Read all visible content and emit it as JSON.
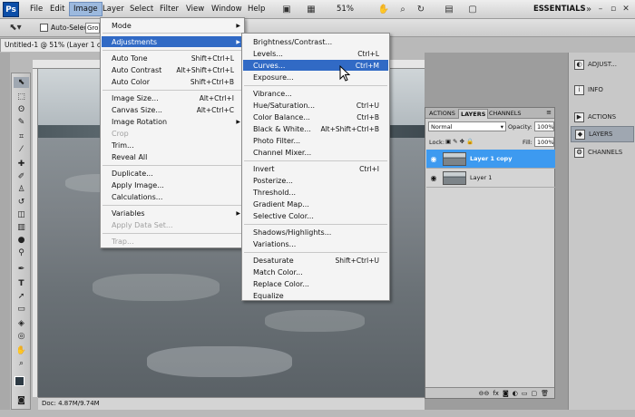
{
  "menubar": {
    "logo": "Ps",
    "items": [
      "File",
      "Edit",
      "Image",
      "Layer",
      "Select",
      "Filter",
      "View",
      "Window",
      "Help"
    ],
    "zoom": "51%",
    "workspace": "ESSENTIALS"
  },
  "options": {
    "auto_select": "Auto-Select:",
    "group_value": "Gro"
  },
  "document": {
    "tab": "Untitled-1 @ 51% (Layer 1 cop",
    "status": "Doc: 4.87M/9.74M"
  },
  "image_menu": [
    {
      "label": "Mode",
      "shortcut": "",
      "submenu": true
    },
    {
      "label": "Adjustments",
      "shortcut": "",
      "submenu": true,
      "highlight": true
    },
    {
      "label": "Auto Tone",
      "shortcut": "Shift+Ctrl+L"
    },
    {
      "label": "Auto Contrast",
      "shortcut": "Alt+Shift+Ctrl+L"
    },
    {
      "label": "Auto Color",
      "shortcut": "Shift+Ctrl+B"
    },
    {
      "label": "Image Size...",
      "shortcut": "Alt+Ctrl+I"
    },
    {
      "label": "Canvas Size...",
      "shortcut": "Alt+Ctrl+C"
    },
    {
      "label": "Image Rotation",
      "shortcut": "",
      "submenu": true
    },
    {
      "label": "Crop",
      "shortcut": "",
      "disabled": true
    },
    {
      "label": "Trim...",
      "shortcut": ""
    },
    {
      "label": "Reveal All",
      "shortcut": ""
    },
    {
      "label": "Duplicate...",
      "shortcut": ""
    },
    {
      "label": "Apply Image...",
      "shortcut": ""
    },
    {
      "label": "Calculations...",
      "shortcut": ""
    },
    {
      "label": "Variables",
      "shortcut": "",
      "submenu": true
    },
    {
      "label": "Apply Data Set...",
      "shortcut": "",
      "disabled": true
    },
    {
      "label": "Trap...",
      "shortcut": "",
      "disabled": true
    }
  ],
  "adjust_menu": [
    {
      "label": "Brightness/Contrast...",
      "shortcut": ""
    },
    {
      "label": "Levels...",
      "shortcut": "Ctrl+L"
    },
    {
      "label": "Curves...",
      "shortcut": "Ctrl+M",
      "highlight": true
    },
    {
      "label": "Exposure...",
      "shortcut": ""
    },
    {
      "label": "Vibrance...",
      "shortcut": ""
    },
    {
      "label": "Hue/Saturation...",
      "shortcut": "Ctrl+U"
    },
    {
      "label": "Color Balance...",
      "shortcut": "Ctrl+B"
    },
    {
      "label": "Black & White...",
      "shortcut": "Alt+Shift+Ctrl+B"
    },
    {
      "label": "Photo Filter...",
      "shortcut": ""
    },
    {
      "label": "Channel Mixer...",
      "shortcut": ""
    },
    {
      "label": "Invert",
      "shortcut": "Ctrl+I"
    },
    {
      "label": "Posterize...",
      "shortcut": ""
    },
    {
      "label": "Threshold...",
      "shortcut": ""
    },
    {
      "label": "Gradient Map...",
      "shortcut": ""
    },
    {
      "label": "Selective Color...",
      "shortcut": ""
    },
    {
      "label": "Shadows/Highlights...",
      "shortcut": ""
    },
    {
      "label": "Variations...",
      "shortcut": ""
    },
    {
      "label": "Desaturate",
      "shortcut": "Shift+Ctrl+U"
    },
    {
      "label": "Match Color...",
      "shortcut": ""
    },
    {
      "label": "Replace Color...",
      "shortcut": ""
    },
    {
      "label": "Equalize",
      "shortcut": ""
    }
  ],
  "layers_panel": {
    "tabs": [
      "ACTIONS",
      "LAYERS",
      "CHANNELS"
    ],
    "blend_mode": "Normal",
    "opacity_label": "Opacity:",
    "opacity": "100%",
    "lock_label": "Lock:",
    "fill_label": "Fill:",
    "fill": "100%",
    "layers": [
      {
        "name": "Layer 1 copy",
        "selected": true
      },
      {
        "name": "Layer 1",
        "selected": false
      }
    ]
  },
  "dock": {
    "adjust": "ADJUST...",
    "info": "INFO",
    "actions": "ACTIONS",
    "layers": "LAYERS",
    "channels": "CHANNELS"
  },
  "colors": {
    "highlight": "#316ac5",
    "layer_selected": "#3d9af0",
    "menu_active": "#9cb9de"
  }
}
